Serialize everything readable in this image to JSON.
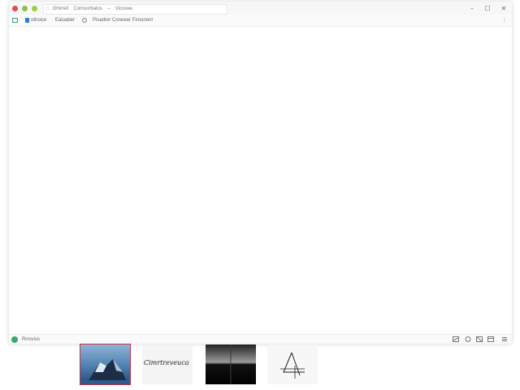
{
  "window": {
    "controls": {
      "close_color": "#e5484d",
      "minimize_color": "#8bc34a",
      "maximize_color": "#9ccc3a"
    },
    "address": {
      "lead_icon": "page-icon",
      "part1": "Ghirrell",
      "part2": "Comsorbalos",
      "sep": "–",
      "part3": "Viccoee"
    },
    "buttons": {
      "minimize": "–",
      "maximize": "☐",
      "close": "✕"
    }
  },
  "toolbar": {
    "item1": {
      "icon": "image-icon",
      "label": "othoice"
    },
    "item2": {
      "icon": "bookmark-icon",
      "label": "Ealuaber"
    },
    "item3": {
      "icon": "shield-icon",
      "label": "Pisadrer  Coneeer  Firoonent"
    },
    "menu_icon": "⋮"
  },
  "status": {
    "label": "Rrrovivs",
    "icons": [
      "image-icon",
      "clock-icon",
      "gallery-icon",
      "window-icon",
      "list-icon"
    ]
  },
  "thumbnails": [
    {
      "name": "iceberg-photo"
    },
    {
      "name": "signature-image",
      "text": "Cimrtreveuca"
    },
    {
      "name": "horizon-gradient"
    },
    {
      "name": "drawing-sketch"
    }
  ]
}
